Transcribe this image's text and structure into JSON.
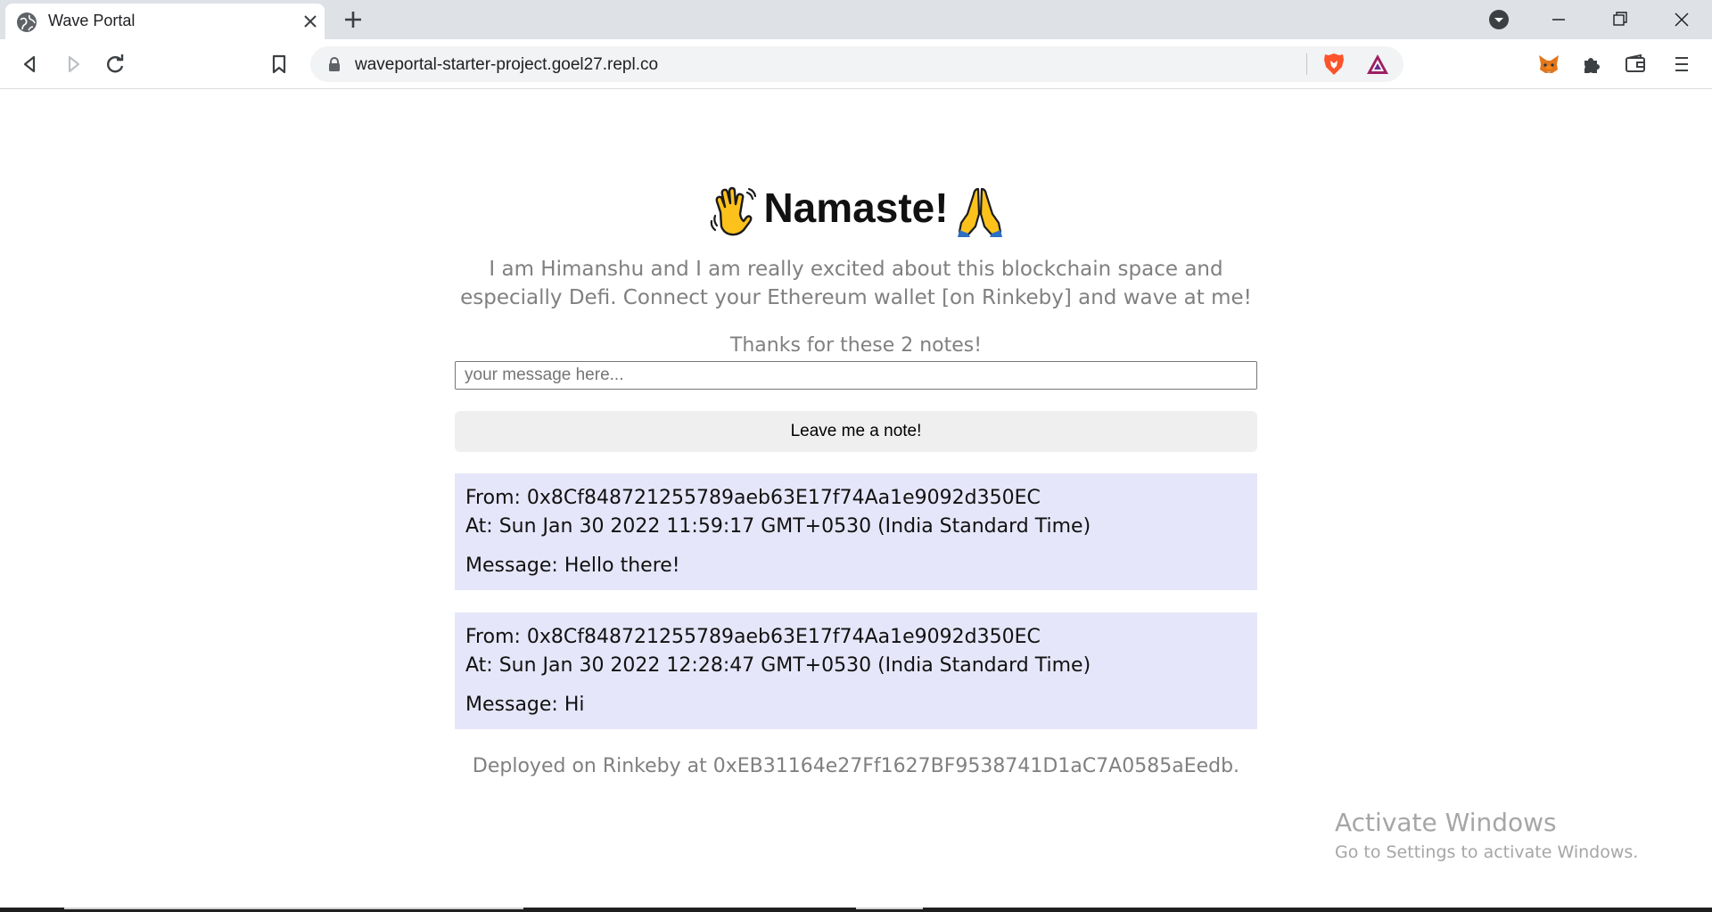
{
  "browser": {
    "tab": {
      "title": "Wave Portal"
    },
    "url": "waveportal-starter-project.goel27.repl.co"
  },
  "page": {
    "header": {
      "title": "Namaste!"
    },
    "bio": "I am Himanshu and I am really excited about this blockchain space and especially Defi. Connect your Ethereum wallet [on Rinkeby] and wave at me!",
    "thanks": "Thanks for these 2 notes!",
    "message_input": {
      "placeholder": "your message here...",
      "value": ""
    },
    "wave_button": {
      "label": "Leave me a note!"
    },
    "notes": [
      {
        "from": "From: 0x8Cf848721255789aeb63E17f74Aa1e9092d350EC",
        "at": "At: Sun Jan 30 2022 11:59:17 GMT+0530 (India Standard Time)",
        "message": "Message: Hello there!"
      },
      {
        "from": "From: 0x8Cf848721255789aeb63E17f74Aa1e9092d350EC",
        "at": "At: Sun Jan 30 2022 12:28:47 GMT+0530 (India Standard Time)",
        "message": "Message: Hi"
      }
    ],
    "footer": "Deployed on Rinkeby at 0xEB31164e27Ff1627BF9538741D1aC7A0585aEedb."
  },
  "watermark": {
    "title": "Activate Windows",
    "subtitle": "Go to Settings to activate Windows."
  },
  "colors": {
    "note_background": "#e6e6fa",
    "muted_text": "#808080",
    "button_background": "#efefef"
  },
  "icons": [
    "globe-icon",
    "close-icon",
    "plus-icon",
    "tab-search-icon",
    "minimize-icon",
    "restore-icon",
    "window-close-icon",
    "back-icon",
    "forward-icon",
    "reload-icon",
    "bookmark-icon",
    "lock-icon",
    "brave-shields-icon",
    "brave-rewards-icon",
    "metamask-fox-icon",
    "extensions-icon",
    "wallet-icon",
    "menu-icon",
    "waving-hand-icon",
    "folded-hands-icon"
  ]
}
